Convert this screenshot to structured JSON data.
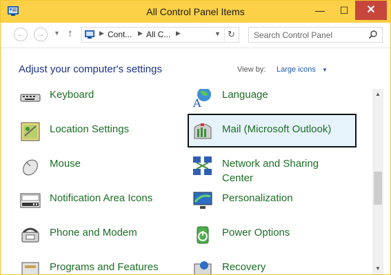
{
  "window": {
    "title": "All Control Panel Items",
    "controls": {
      "minimize": "—",
      "maximize": "☐",
      "close": "✕"
    }
  },
  "nav": {
    "back_icon": "arrow-left-icon",
    "forward_icon": "arrow-right-icon",
    "up_icon": "arrow-up-icon",
    "breadcrumb": [
      "Cont...",
      "All C..."
    ],
    "refresh_icon": "refresh-icon",
    "search_placeholder": "Search Control Panel"
  },
  "header": {
    "title": "Adjust your computer's settings",
    "view_by_label": "View by:",
    "view_by_value": "Large icons"
  },
  "items": [
    {
      "label": "Keyboard",
      "icon": "keyboard-icon"
    },
    {
      "label": "Language",
      "icon": "language-icon"
    },
    {
      "label": "Location Settings",
      "icon": "location-icon"
    },
    {
      "label": "Mail (Microsoft Outlook)",
      "icon": "mail-icon",
      "selected": true
    },
    {
      "label": "Mouse",
      "icon": "mouse-icon"
    },
    {
      "label": "Network and Sharing Center",
      "icon": "network-icon"
    },
    {
      "label": "Notification Area Icons",
      "icon": "notification-icon"
    },
    {
      "label": "Personalization",
      "icon": "personalization-icon"
    },
    {
      "label": "Phone and Modem",
      "icon": "phone-icon"
    },
    {
      "label": "Power Options",
      "icon": "power-icon"
    },
    {
      "label": "Programs and Features",
      "icon": "programs-icon"
    },
    {
      "label": "Recovery",
      "icon": "recovery-icon"
    }
  ],
  "colors": {
    "titlebar": "#fcd047",
    "close_button": "#c7463b",
    "link_green": "#1c6e25",
    "heading_blue": "#1e3287",
    "selection": "#e7f3fb"
  }
}
